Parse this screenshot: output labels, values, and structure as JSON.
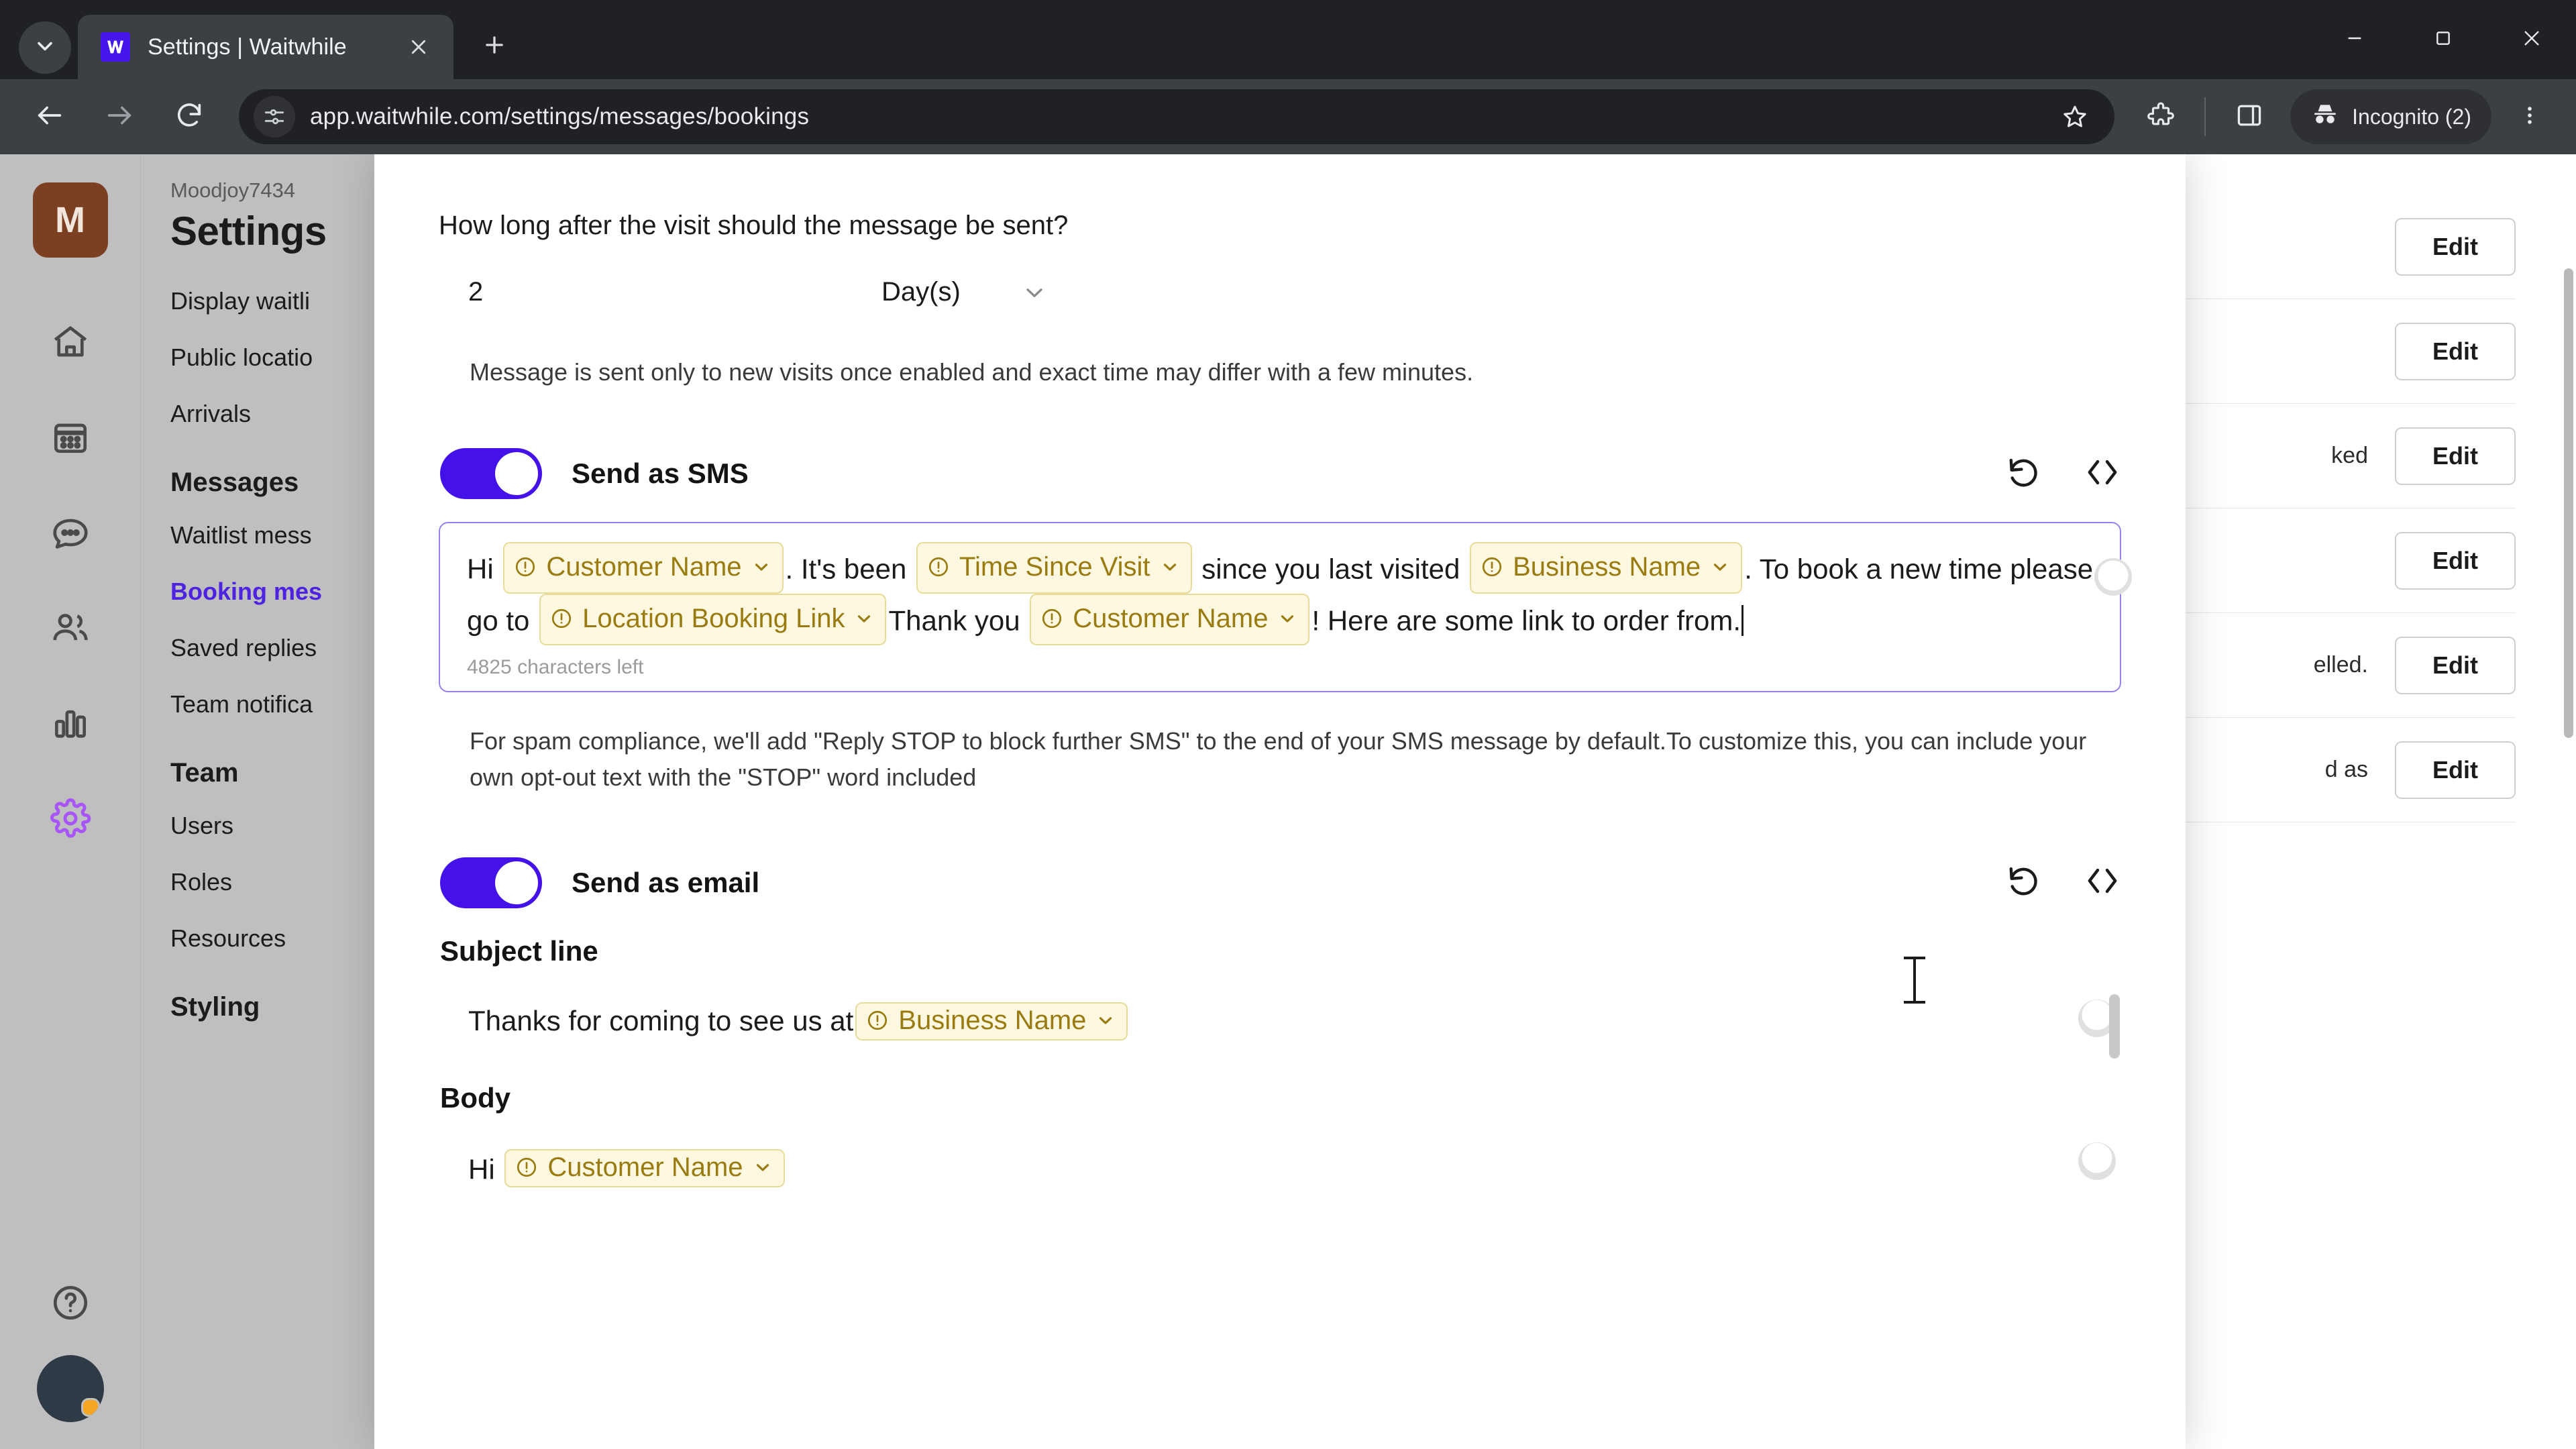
{
  "browser": {
    "tab": {
      "title": "Settings | Waitwhile",
      "favicon_icon": "waitwhile-logo-icon",
      "close_icon": "close-icon"
    },
    "tab_search_icon": "chevron-down-icon",
    "new_tab_icon": "plus-icon",
    "window_controls": {
      "minimize_icon": "minimize-icon",
      "maximize_icon": "maximize-icon",
      "close_icon": "close-icon"
    },
    "nav": {
      "back_icon": "arrow-left-icon",
      "forward_icon": "arrow-right-icon",
      "reload_icon": "reload-icon"
    },
    "omnibox": {
      "url": "app.waitwhile.com/settings/messages/bookings",
      "site_settings_icon": "tune-icon",
      "bookmark_icon": "star-icon"
    },
    "toolbar": {
      "extensions_icon": "extensions-icon",
      "side_panel_icon": "side-panel-icon",
      "incognito_label": "Incognito (2)",
      "incognito_icon": "incognito-icon",
      "menu_icon": "three-dot-menu-icon"
    }
  },
  "app": {
    "rail": {
      "workspace_initial": "M",
      "items": [
        {
          "name": "home-icon"
        },
        {
          "name": "calendar-icon"
        },
        {
          "name": "messages-icon"
        },
        {
          "name": "customers-icon"
        },
        {
          "name": "analytics-icon"
        },
        {
          "name": "settings-gear-icon"
        }
      ],
      "help_icon": "help-circle-icon",
      "avatar": "user-avatar"
    },
    "settings_nav": {
      "breadcrumb": "Moodjoy7434",
      "title": "Settings",
      "items": [
        {
          "label": "Display waitli",
          "active": false
        },
        {
          "label": "Public locatio",
          "active": false
        },
        {
          "label": "Arrivals",
          "active": false
        }
      ],
      "group_messages": "Messages",
      "messages_items": [
        {
          "label": "Waitlist mess",
          "active": false
        },
        {
          "label": "Booking mes",
          "active": true
        },
        {
          "label": "Saved replies",
          "active": false
        },
        {
          "label": "Team notifica",
          "active": false
        }
      ],
      "group_team": "Team",
      "team_items": [
        {
          "label": "Users",
          "active": false
        },
        {
          "label": "Roles",
          "active": false
        },
        {
          "label": "Resources",
          "active": false
        }
      ],
      "group_styling": "Styling"
    },
    "background_rows": [
      {
        "text": "",
        "edit_label": "Edit"
      },
      {
        "text": "",
        "edit_label": "Edit"
      },
      {
        "text": "ked",
        "edit_label": "Edit"
      },
      {
        "text": "",
        "edit_label": "Edit"
      },
      {
        "text": "elled.",
        "edit_label": "Edit"
      },
      {
        "text": "d as",
        "edit_label": "Edit"
      }
    ]
  },
  "modal": {
    "question_label": "How long after the visit should the message be sent?",
    "duration": {
      "value": "2",
      "unit": "Day(s)",
      "chevron_icon": "chevron-down-icon"
    },
    "hint": "Message is sent only to new visits once enabled and exact time may differ with a few minutes.",
    "sms": {
      "toggle_label": "Send as SMS",
      "toggle_on": true,
      "reset_icon": "reset-icon",
      "code_icon": "code-brackets-icon",
      "add_variable_icon": "plus-circle-icon",
      "segments": [
        {
          "type": "text",
          "value": "Hi "
        },
        {
          "type": "token",
          "value": "Customer Name"
        },
        {
          "type": "text",
          "value": ". It's been "
        },
        {
          "type": "token",
          "value": "Time Since Visit"
        },
        {
          "type": "text",
          "value": " since you last visited "
        },
        {
          "type": "token",
          "value": "Business Name"
        },
        {
          "type": "text",
          "value": ". To book a new time please go to "
        },
        {
          "type": "token",
          "value": "Location Booking Link"
        },
        {
          "type": "text",
          "value": "Thank you "
        },
        {
          "type": "token",
          "value": "Customer Name"
        },
        {
          "type": "text",
          "value": "! Here are some link to order from."
        }
      ],
      "characters_left": "4825 characters left",
      "compliance_text": "For spam compliance, we'll add \"Reply STOP to block further SMS\" to the end of your SMS message by default.To customize this, you can include your own opt-out text with the \"STOP\" word included"
    },
    "email": {
      "toggle_label": "Send as email",
      "toggle_on": true,
      "reset_icon": "reset-icon",
      "code_icon": "code-brackets-icon",
      "subject_label": "Subject line",
      "subject_segments": [
        {
          "type": "text",
          "value": "Thanks for coming to see us at "
        },
        {
          "type": "token",
          "value": "Business Name"
        }
      ],
      "body_label": "Body",
      "body_segments": [
        {
          "type": "text",
          "value": "Hi "
        },
        {
          "type": "token",
          "value": "Customer Name"
        }
      ],
      "add_variable_icon": "plus-circle-icon"
    }
  },
  "colors": {
    "accent_purple": "#4411e8",
    "token_text": "#9a7b12",
    "token_bg": "#fdf8df",
    "token_border": "#e7dc9a",
    "editor_border": "#9a7ff0",
    "nav_active": "#4d22e0"
  }
}
